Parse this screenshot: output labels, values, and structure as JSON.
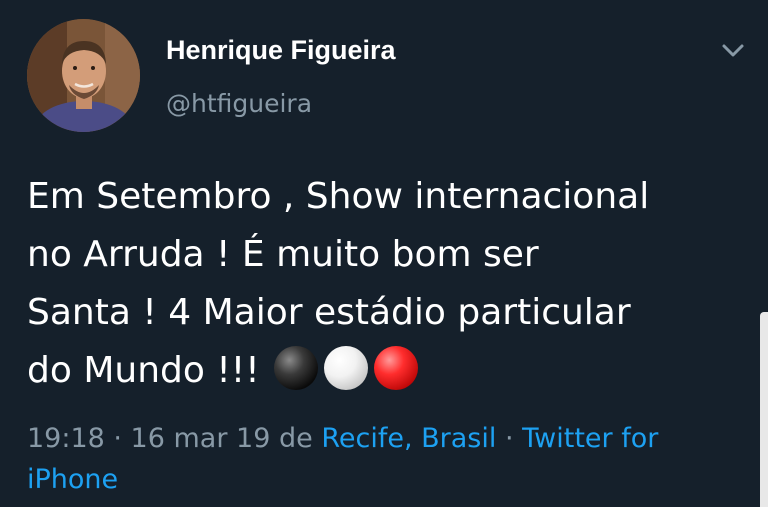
{
  "author": {
    "display_name": "Henrique Figueira",
    "handle": "@htfigueira"
  },
  "tweet": {
    "lines": [
      "Em Setembro , Show internacional",
      "no Arruda ! É muito bom ser",
      "Santa ! 4 Maior estádio particular",
      "do Mundo !!!"
    ],
    "emoji": [
      "black-circle-icon",
      "white-circle-icon",
      "red-circle-icon"
    ]
  },
  "meta": {
    "time_date": "19:18 · 16 mar 19",
    "de": "de",
    "location": "Recife, Brasil",
    "separator": "·",
    "source": "Twitter for iPhone"
  },
  "colors": {
    "background": "#15202b",
    "primary_text": "#ffffff",
    "secondary_text": "#8899a6",
    "link": "#1da1f2"
  }
}
